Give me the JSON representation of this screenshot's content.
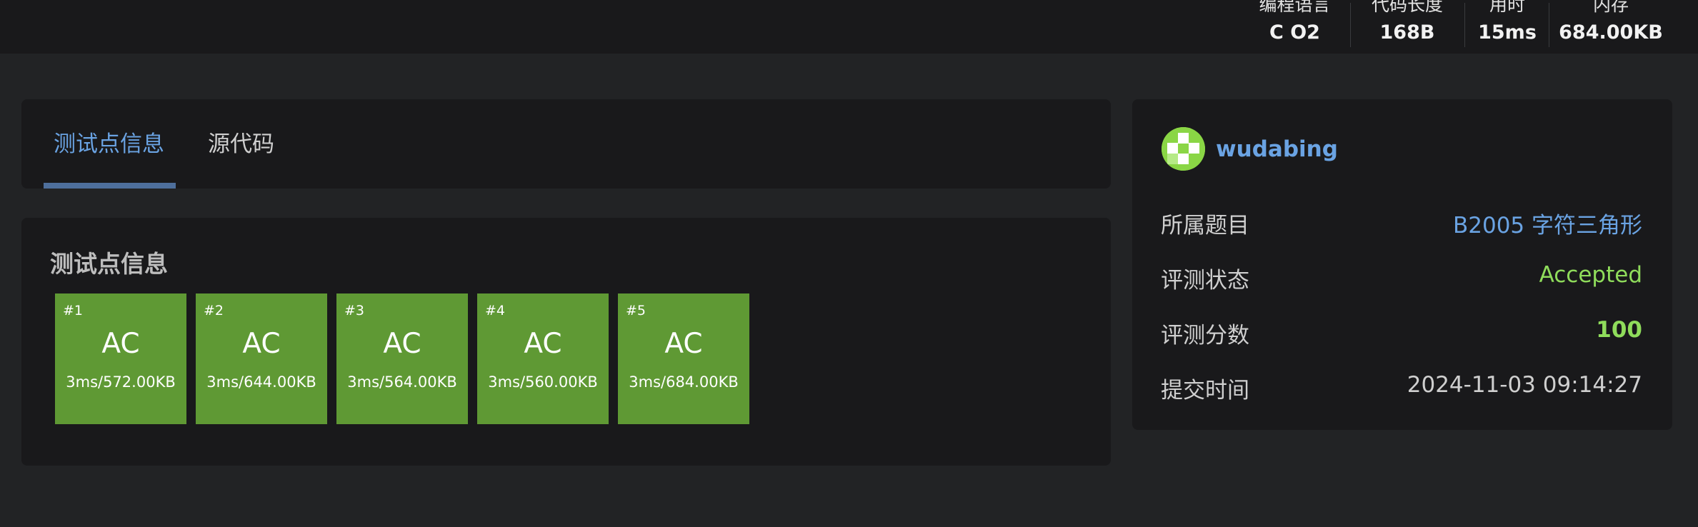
{
  "header": {
    "stats": [
      {
        "label": "编程语言",
        "value": "C O2"
      },
      {
        "label": "代码长度",
        "value": "168B"
      },
      {
        "label": "用时",
        "value": "15ms"
      },
      {
        "label": "内存",
        "value": "684.00KB"
      }
    ]
  },
  "tabs": [
    {
      "label": "测试点信息",
      "active": true
    },
    {
      "label": "源代码",
      "active": false
    }
  ],
  "testcases": {
    "title": "测试点信息",
    "items": [
      {
        "id": "#1",
        "status": "AC",
        "detail": "3ms/572.00KB"
      },
      {
        "id": "#2",
        "status": "AC",
        "detail": "3ms/644.00KB"
      },
      {
        "id": "#3",
        "status": "AC",
        "detail": "3ms/564.00KB"
      },
      {
        "id": "#4",
        "status": "AC",
        "detail": "3ms/560.00KB"
      },
      {
        "id": "#5",
        "status": "AC",
        "detail": "3ms/684.00KB"
      }
    ]
  },
  "submission": {
    "user": "wudabing",
    "rows": [
      {
        "label": "所属题目",
        "value": "B2005 字符三角形"
      },
      {
        "label": "评测状态",
        "value": "Accepted"
      },
      {
        "label": "评测分数",
        "value": "100"
      },
      {
        "label": "提交时间",
        "value": "2024-11-03 09:14:27"
      }
    ]
  },
  "colors": {
    "accent": "#6aa3e3",
    "ac_green": "#5f9934",
    "accepted_text": "#8fdc5b",
    "background": "#222325",
    "card": "#19191b"
  },
  "icons": {
    "avatar": "user-avatar-icon"
  }
}
